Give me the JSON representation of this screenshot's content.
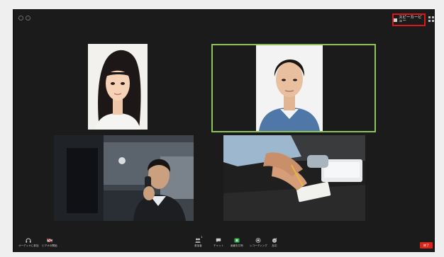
{
  "header": {
    "speaker_view_label": "スピーカービュー"
  },
  "participants": [
    {
      "tile": "top-left",
      "description_icon": "woman-portrait"
    },
    {
      "tile": "top-right",
      "description_icon": "man-portrait",
      "active_speaker": true
    },
    {
      "tile": "bottom-left",
      "description_icon": "man-on-phone"
    },
    {
      "tile": "bottom-right",
      "description_icon": "hands-writing"
    }
  ],
  "toolbar": {
    "audio_label": "オーディオに参加",
    "video_label": "ビデオの開始",
    "participants_label": "参加者",
    "participants_count": "1",
    "chat_label": "チャット",
    "share_label": "画面を共有",
    "record_label": "レコーディング",
    "reactions_label": "反応",
    "end_label": "終了"
  },
  "colors": {
    "active_speaker_border": "#8dc558",
    "highlight_box": "#e01616",
    "share_icon": "#2fb84a",
    "end_button": "#d9241c"
  }
}
